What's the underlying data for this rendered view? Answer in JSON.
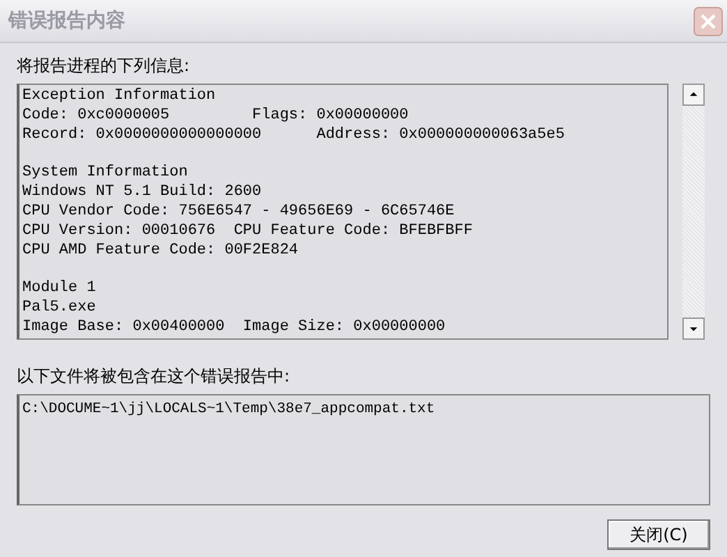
{
  "window": {
    "title": "错误报告内容"
  },
  "report": {
    "label": "将报告进程的下列信息:",
    "sections": [
      [
        "Exception Information",
        "Code: 0xc0000005         Flags: 0x00000000",
        "Record: 0x0000000000000000      Address: 0x000000000063a5e5"
      ],
      [
        "System Information",
        "Windows NT 5.1 Build: 2600",
        "CPU Vendor Code: 756E6547 - 49656E69 - 6C65746E",
        "CPU Version: 00010676  CPU Feature Code: BFEBFBFF",
        "CPU AMD Feature Code: 00F2E824"
      ],
      [
        "Module 1",
        "Pal5.exe",
        "Image Base: 0x00400000  Image Size: 0x00000000"
      ]
    ]
  },
  "files": {
    "label": "以下文件将被包含在这个错误报告中:",
    "items": [
      "C:\\DOCUME~1\\jj\\LOCALS~1\\Temp\\38e7_appcompat.txt"
    ]
  },
  "buttons": [
    "关闭(C)"
  ]
}
